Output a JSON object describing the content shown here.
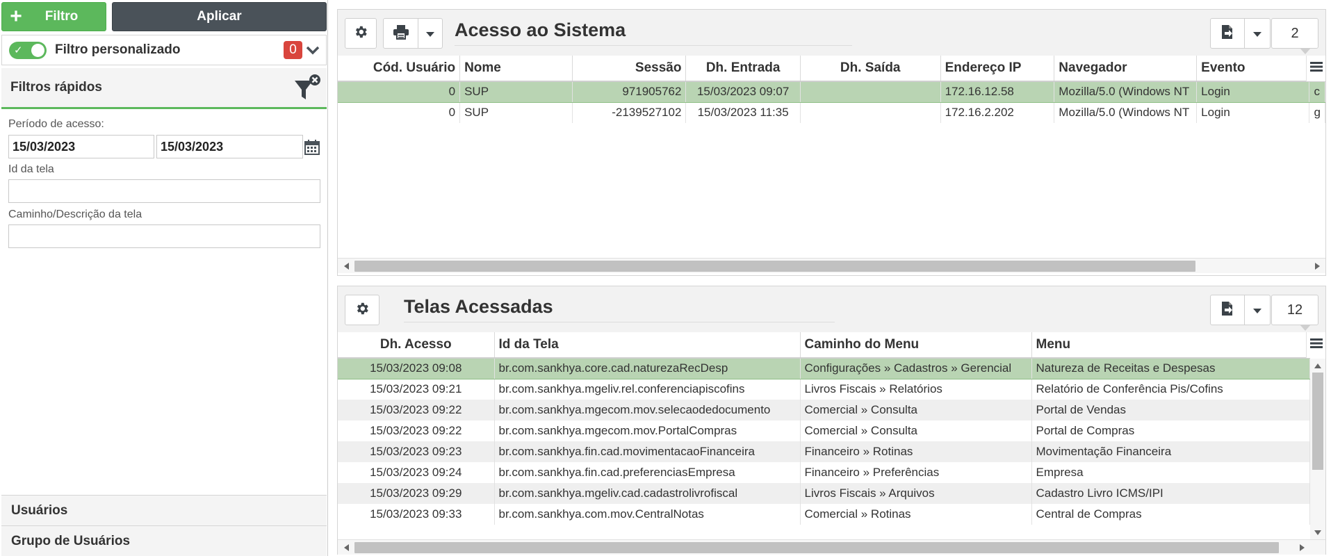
{
  "toolbar": {
    "filter_label": "Filtro",
    "apply_label": "Aplicar"
  },
  "custom_filter": {
    "label": "Filtro personalizado",
    "count": "0"
  },
  "quick_filters": {
    "title": "Filtros rápidos",
    "period_label": "Período de acesso:",
    "date_from": "15/03/2023",
    "date_to": "15/03/2023",
    "screen_id_label": "Id da tela",
    "screen_id_value": "",
    "path_label": "Caminho/Descrição da tela",
    "path_value": ""
  },
  "accordion": {
    "users": "Usuários",
    "user_groups": "Grupo de Usuários"
  },
  "access_panel": {
    "title": "Acesso ao Sistema",
    "count": "2",
    "columns": [
      "Cód. Usuário",
      "Nome",
      "Sessão",
      "Dh. Entrada",
      "Dh. Saída",
      "Endereço IP",
      "Navegador",
      "Evento"
    ],
    "rows": [
      [
        "0",
        "SUP",
        "971905762",
        "15/03/2023 09:07",
        "",
        "172.16.12.58",
        "Mozilla/5.0 (Windows NT",
        "Login",
        "c"
      ],
      [
        "0",
        "SUP",
        "-2139527102",
        "15/03/2023 11:35",
        "",
        "172.16.2.202",
        "Mozilla/5.0 (Windows NT",
        "Login",
        "g"
      ]
    ]
  },
  "screens_panel": {
    "title": "Telas Acessadas",
    "count": "12",
    "columns": [
      "Dh. Acesso",
      "Id da Tela",
      "Caminho do Menu",
      "Menu"
    ],
    "rows": [
      [
        "15/03/2023 09:08",
        "br.com.sankhya.core.cad.naturezaRecDesp",
        "Configurações » Cadastros » Gerencial",
        "Natureza de Receitas e Despesas"
      ],
      [
        "15/03/2023 09:21",
        "br.com.sankhya.mgeliv.rel.conferenciapiscofins",
        "Livros Fiscais » Relatórios",
        "Relatório de Conferência Pis/Cofins"
      ],
      [
        "15/03/2023 09:22",
        "br.com.sankhya.mgecom.mov.selecaodedocumento",
        "Comercial » Consulta",
        "Portal de Vendas"
      ],
      [
        "15/03/2023 09:22",
        "br.com.sankhya.mgecom.mov.PortalCompras",
        "Comercial » Consulta",
        "Portal de Compras"
      ],
      [
        "15/03/2023 09:23",
        "br.com.sankhya.fin.cad.movimentacaoFinanceira",
        "Financeiro » Rotinas",
        "Movimentação Financeira"
      ],
      [
        "15/03/2023 09:24",
        "br.com.sankhya.fin.cad.preferenciasEmpresa",
        "Financeiro » Preferências",
        "Empresa"
      ],
      [
        "15/03/2023 09:29",
        "br.com.sankhya.mgeliv.cad.cadastrolivrofiscal",
        "Livros Fiscais » Arquivos",
        "Cadastro Livro ICMS/IPI"
      ],
      [
        "15/03/2023 09:33",
        "br.com.sankhya.com.mov.CentralNotas",
        "Comercial » Rotinas",
        "Central de Compras"
      ]
    ]
  },
  "colors": {
    "green": "#5cb85c",
    "dark": "#4a5259",
    "selected_row": "#b9d4b3",
    "badge_red": "#d9453d"
  },
  "icons": [
    "plus-icon",
    "toggle-check-icon",
    "chevron-down-icon",
    "funnel-clear-icon",
    "calendar-icon",
    "gear-icon",
    "printer-icon",
    "caret-down-icon",
    "export-icon",
    "hamburger-icon",
    "arrow-left-icon",
    "arrow-right-icon",
    "arrow-up-icon",
    "arrow-down-icon"
  ]
}
